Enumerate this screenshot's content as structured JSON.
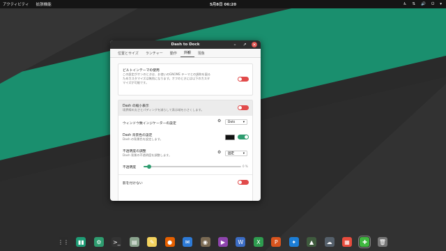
{
  "topbar": {
    "activities": "アクティビティ",
    "app_menu": "拡張機能",
    "clock": "5月8日 06:20",
    "tray_icons": [
      "accessibility-icon",
      "network-icon",
      "volume-icon",
      "power-icon",
      "chevron-down-icon"
    ]
  },
  "window": {
    "title": "Dash to Dock",
    "controls": {
      "minimize": "–",
      "maximize": "↗",
      "close": "✕"
    },
    "tabs": [
      "位置とサイズ",
      "ランチャー",
      "動作",
      "外観",
      "現象"
    ],
    "active_tab": "外観"
  },
  "settings": {
    "builtin_theme": {
      "title": "ビルトインテーマの使用",
      "desc1": "この設定がオンのときは、お使いのGNOME テーマとの調和を図る",
      "desc2": "ためカスタマイズは無効になります。オフのときには以下のカスタ",
      "desc3": "マイズが可能です。",
      "toggle": "off"
    },
    "shrink": {
      "title": "Dash の縮小表示",
      "desc": "境界線の太さとパディングを減らして表示域を小さくします。",
      "toggle": "off"
    },
    "indicator": {
      "title": "ウィンドウ数インジケーターの設定",
      "value": "Dots"
    },
    "bg_color": {
      "title": "Dash 背景色の設定",
      "desc": "Dash の背景色を設定します。",
      "toggle": "on",
      "swatch_color": "#111111"
    },
    "opacity": {
      "title": "不透明度の調整",
      "desc": "Dash 背景の不透明度を調整します。",
      "value": "固定"
    },
    "opacity_slider": {
      "label": "不透明度",
      "value_label": "0 %",
      "fraction": 0.02
    },
    "no_shadow": {
      "title": "影を付けない",
      "toggle": "off"
    }
  },
  "dock": {
    "icons": [
      {
        "name": "show-apps-icon",
        "color": "#2b2b2b",
        "glyph": "⋮⋮"
      },
      {
        "name": "manjaro-hello-icon",
        "color": "#1e9c75",
        "glyph": "▮▮"
      },
      {
        "name": "settings-app-icon",
        "color": "#2e9c6f",
        "glyph": "⚙"
      },
      {
        "name": "terminal-icon",
        "color": "#333333",
        "glyph": ">_"
      },
      {
        "name": "files-icon",
        "color": "#8aa38d",
        "glyph": "▤"
      },
      {
        "name": "text-editor-icon",
        "color": "#f4d35e",
        "glyph": "✎"
      },
      {
        "name": "firefox-icon",
        "color": "#e66000",
        "glyph": "●"
      },
      {
        "name": "thunderbird-icon",
        "color": "#2d7ad6",
        "glyph": "✉"
      },
      {
        "name": "gimp-icon",
        "color": "#7a6a53",
        "glyph": "◉"
      },
      {
        "name": "video-player-icon",
        "color": "#8e44ad",
        "glyph": "▶"
      },
      {
        "name": "office-writer-icon",
        "color": "#3b6cc4",
        "glyph": "W"
      },
      {
        "name": "office-calc-icon",
        "color": "#2e9c4f",
        "glyph": "X"
      },
      {
        "name": "office-impress-icon",
        "color": "#d9541e",
        "glyph": "P"
      },
      {
        "name": "game-icon",
        "color": "#1c7ed6",
        "glyph": "✦"
      },
      {
        "name": "inkscape-icon",
        "color": "#3f5b3e",
        "glyph": "▲"
      },
      {
        "name": "cloud-icon",
        "color": "#55606b",
        "glyph": "☁"
      },
      {
        "name": "software-center-icon",
        "color": "#e84c3d",
        "glyph": "▦"
      },
      {
        "name": "extensions-icon",
        "color": "#3fb83f",
        "glyph": "✚",
        "active": true
      },
      {
        "name": "trash-icon",
        "color": "#777777",
        "glyph": "🗑"
      }
    ]
  },
  "colors": {
    "accent": "#1a8f6e",
    "toggle_off": "#e14b4b",
    "toggle_on": "#2e9c6f"
  }
}
